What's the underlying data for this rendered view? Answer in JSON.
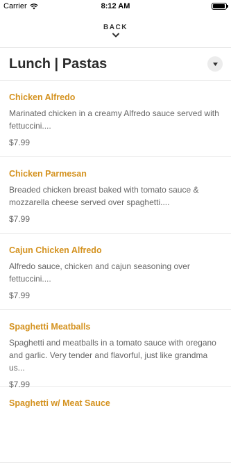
{
  "status_bar": {
    "carrier": "Carrier",
    "time": "8:12 AM"
  },
  "nav": {
    "back_label": "BACK"
  },
  "header": {
    "title": "Lunch | Pastas"
  },
  "menu_items": [
    {
      "name": "Chicken Alfredo",
      "description": "Marinated chicken in a creamy Alfredo sauce served with fettuccini....",
      "price": "$7.99"
    },
    {
      "name": "Chicken Parmesan",
      "description": "Breaded chicken breast baked with tomato sauce & mozzarella cheese served over spaghetti....",
      "price": "$7.99"
    },
    {
      "name": "Cajun Chicken Alfredo",
      "description": "Alfredo sauce, chicken and cajun seasoning over fettuccini....",
      "price": "$7.99"
    },
    {
      "name": "Spaghetti Meatballs",
      "description": "Spaghetti and meatballs in a tomato sauce with oregano and garlic. Very tender and flavorful, just like grandma us...",
      "price": "$7.99"
    },
    {
      "name": "Spaghetti w/ Meat Sauce",
      "description": "",
      "price": ""
    }
  ],
  "colors": {
    "accent": "#d4921f"
  }
}
